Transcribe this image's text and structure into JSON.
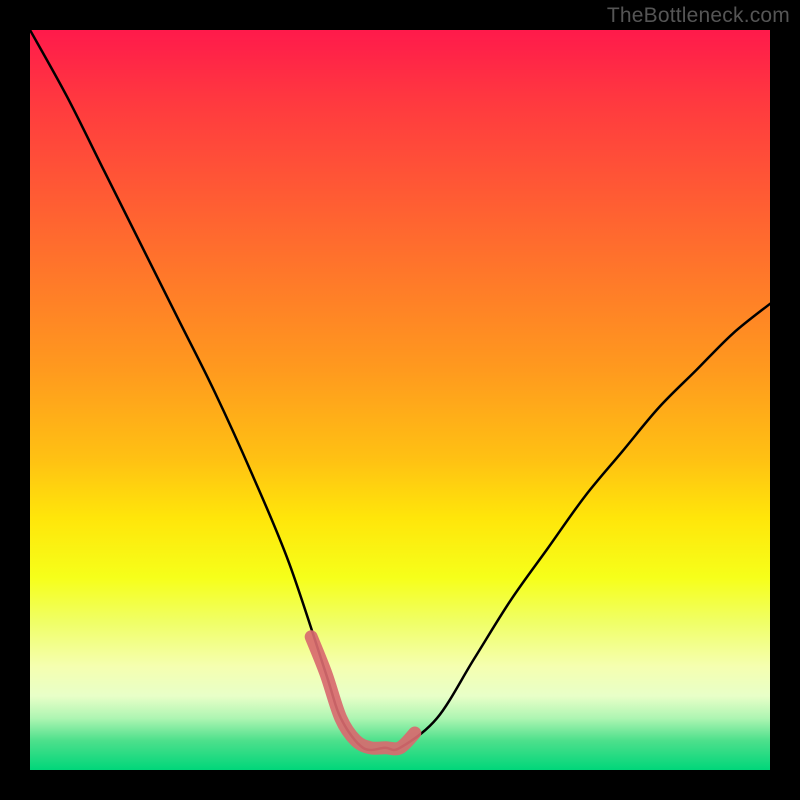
{
  "watermark": "TheBottleneck.com",
  "chart_data": {
    "type": "line",
    "title": "",
    "xlabel": "",
    "ylabel": "",
    "xlim": [
      0,
      100
    ],
    "ylim": [
      0,
      100
    ],
    "series": [
      {
        "name": "bottleneck-curve",
        "x": [
          0,
          5,
          10,
          15,
          20,
          25,
          30,
          35,
          40,
          42,
          45,
          48,
          50,
          55,
          60,
          65,
          70,
          75,
          80,
          85,
          90,
          95,
          100
        ],
        "values": [
          100,
          91,
          81,
          71,
          61,
          51,
          40,
          28,
          13,
          7,
          3,
          3,
          3,
          7,
          15,
          23,
          30,
          37,
          43,
          49,
          54,
          59,
          63
        ]
      }
    ],
    "highlight": {
      "name": "optimal-range",
      "x": [
        38,
        40,
        42,
        44,
        46,
        48,
        50,
        52
      ],
      "values": [
        18,
        13,
        7,
        4,
        3,
        3,
        3,
        5
      ]
    },
    "gradient_stops": [
      {
        "pos": 0,
        "color": "#ff1a4b"
      },
      {
        "pos": 46,
        "color": "#ff9a1e"
      },
      {
        "pos": 74,
        "color": "#f6ff1a"
      },
      {
        "pos": 100,
        "color": "#00d67a"
      }
    ]
  }
}
